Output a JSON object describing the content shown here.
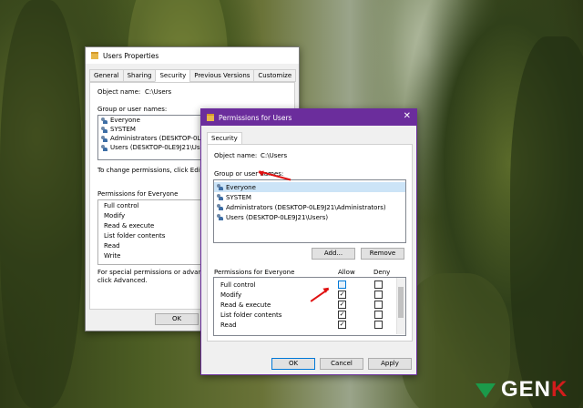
{
  "colors": {
    "accent_purple": "#6b2d9c",
    "selection": "#cce4f7",
    "arrow": "#e01010",
    "logo_red": "#d21c1c"
  },
  "back_dialog": {
    "title": "Users Properties",
    "tabs": [
      "General",
      "Sharing",
      "Security",
      "Previous Versions",
      "Customize"
    ],
    "active_tab": "Security",
    "object_name_label": "Object name:",
    "object_name_value": "C:\\Users",
    "group_label": "Group or user names:",
    "users": [
      "Everyone",
      "SYSTEM",
      "Administrators (DESKTOP-0LE9",
      "Users (DESKTOP-0LE9J21\\Users)"
    ],
    "change_text": "To change permissions, click Edit.",
    "perm_label": "Permissions for Everyone",
    "perms": [
      "Full control",
      "Modify",
      "Read & execute",
      "List folder contents",
      "Read",
      "Write"
    ],
    "special_text_1": "For special permissions or advanced",
    "special_text_2": "click Advanced.",
    "ok_label": "OK"
  },
  "front_dialog": {
    "title": "Permissions for Users",
    "close_glyph": "✕",
    "tab": "Security",
    "object_name_label": "Object name:",
    "object_name_value": "C:\\Users",
    "group_label": "Group or user names:",
    "users": [
      "Everyone",
      "SYSTEM",
      "Administrators (DESKTOP-0LE9J21\\Administrators)",
      "Users (DESKTOP-0LE9J21\\Users)"
    ],
    "selected_user": "Everyone",
    "add_label": "Add...",
    "remove_label": "Remove",
    "perm_label": "Permissions for Everyone",
    "allow_label": "Allow",
    "deny_label": "Deny",
    "perms": [
      {
        "name": "Full control",
        "allow": "",
        "deny": ""
      },
      {
        "name": "Modify",
        "allow": "✓",
        "deny": ""
      },
      {
        "name": "Read & execute",
        "allow": "✓",
        "deny": ""
      },
      {
        "name": "List folder contents",
        "allow": "✓",
        "deny": ""
      },
      {
        "name": "Read",
        "allow": "✓",
        "deny": ""
      }
    ],
    "ok_label": "OK",
    "cancel_label": "Cancel",
    "apply_label": "Apply"
  },
  "watermark": {
    "text_main": "GEN",
    "text_accent": "K"
  }
}
